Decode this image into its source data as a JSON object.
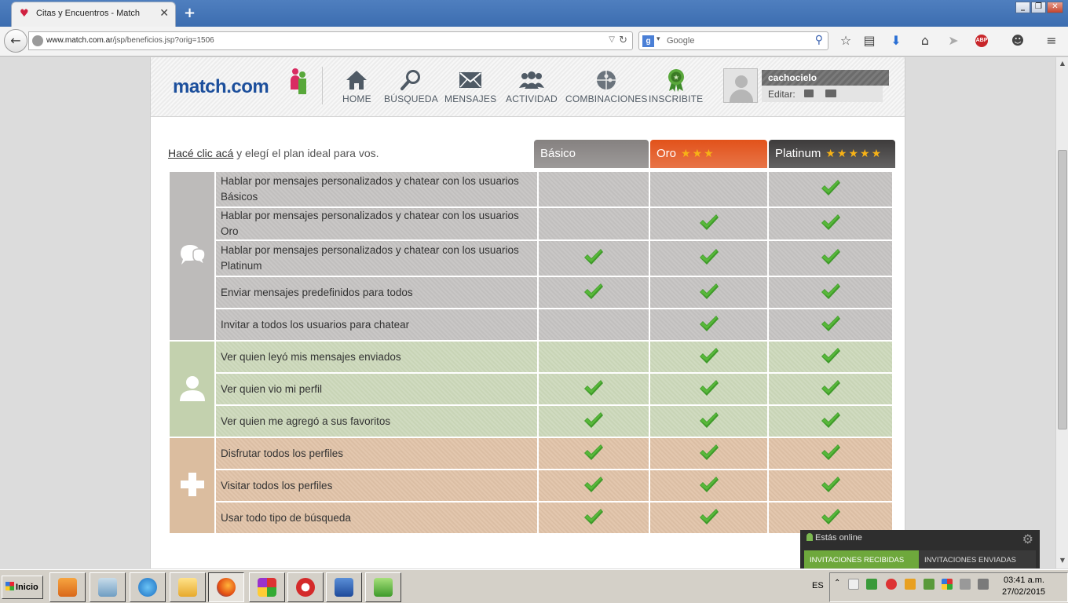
{
  "browser": {
    "tab_title": "Citas y Encuentros - Match",
    "url_host": "www.match.com.ar",
    "url_path": "/jsp/beneficios.jsp?orig=1506",
    "search_engine": "Google"
  },
  "site": {
    "logo": "match.com",
    "nav": [
      {
        "label": "HOME",
        "icon": "home-icon"
      },
      {
        "label": "BÚSQUEDA",
        "icon": "search-icon"
      },
      {
        "label": "MENSAJES",
        "icon": "envelope-icon"
      },
      {
        "label": "ACTIVIDAD",
        "icon": "people-icon"
      },
      {
        "label": "COMBINACIONES",
        "icon": "puzzle-icon"
      },
      {
        "label": "INSCRIBITE",
        "icon": "badge-icon"
      }
    ],
    "user": {
      "name": "cachocielo",
      "edit_label": "Editar:"
    }
  },
  "intro": {
    "link": "Hacé clic acá",
    "text": " y elegí el plan ideal para vos."
  },
  "plans": [
    {
      "name": "Básico",
      "stars": "",
      "color": "#858180"
    },
    {
      "name": "Oro",
      "stars": "★★★",
      "color": "#e2521a"
    },
    {
      "name": "Platinum",
      "stars": "★★★★★",
      "color": "#3d3b3b"
    }
  ],
  "groups": [
    {
      "class": "grp-grey",
      "icon": "chat-icon",
      "features": [
        {
          "label": "Hablar por mensajes personalizados y chatear con los usuarios Básicos",
          "checks": [
            false,
            false,
            true
          ]
        },
        {
          "label": "Hablar por mensajes personalizados y chatear con los usuarios Oro",
          "checks": [
            false,
            true,
            true
          ]
        },
        {
          "label": "Hablar por mensajes personalizados y chatear con los usuarios Platinum",
          "checks": [
            true,
            true,
            true
          ]
        },
        {
          "label": "Enviar mensajes predefinidos para todos",
          "checks": [
            true,
            true,
            true
          ]
        },
        {
          "label": "Invitar a todos los usuarios para chatear",
          "checks": [
            false,
            true,
            true
          ]
        }
      ]
    },
    {
      "class": "grp-green",
      "icon": "user-icon",
      "features": [
        {
          "label": "Ver quien leyó mis mensajes enviados",
          "checks": [
            false,
            true,
            true
          ]
        },
        {
          "label": "Ver quien vio mi perfil",
          "checks": [
            true,
            true,
            true
          ]
        },
        {
          "label": "Ver quien me agregó a sus favoritos",
          "checks": [
            true,
            true,
            true
          ]
        }
      ]
    },
    {
      "class": "grp-tan",
      "icon": "plus-icon",
      "features": [
        {
          "label": "Disfrutar todos los perfiles",
          "checks": [
            true,
            true,
            true
          ]
        },
        {
          "label": "Visitar todos los perfiles",
          "checks": [
            true,
            true,
            true
          ]
        },
        {
          "label": "Usar todo tipo de búsqueda",
          "checks": [
            true,
            true,
            true
          ]
        }
      ]
    }
  ],
  "chat": {
    "status": "Estás online",
    "tab_received": "INVITACIONES RECIBIDAS",
    "tab_sent": "INVITACIONES ENVIADAS"
  },
  "taskbar": {
    "start_label": "Inicio",
    "lang": "ES",
    "time": "03:41 a.m.",
    "date": "27/02/2015"
  }
}
